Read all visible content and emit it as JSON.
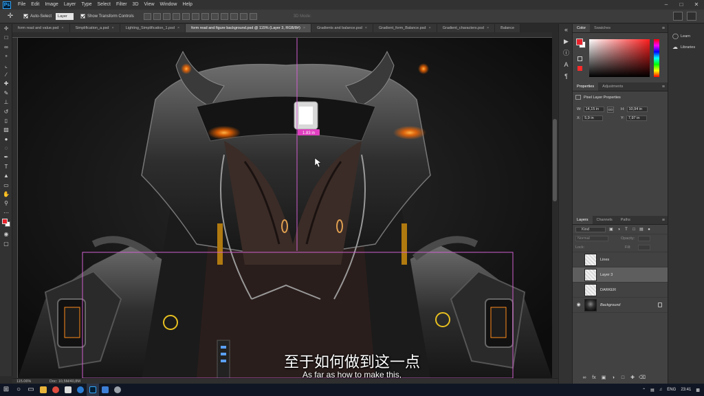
{
  "menu": [
    "File",
    "Edit",
    "Image",
    "Layer",
    "Type",
    "Select",
    "Filter",
    "3D",
    "View",
    "Window",
    "Help"
  ],
  "app_logo": "Ps",
  "options": {
    "auto_select_label": "Auto-Select",
    "auto_select_target": "Layer",
    "transform_label": "Show Transform Controls",
    "mode_3d_label": "3D Mode:"
  },
  "tabs": [
    {
      "label": "form read and value.psd",
      "active": false
    },
    {
      "label": "Simplification_a.psd",
      "active": false
    },
    {
      "label": "Lighting_Simplification_1.psd",
      "active": false
    },
    {
      "label": "form read and figure background.psd @ 115% (Layer 3, RGB/8#)",
      "active": true
    },
    {
      "label": "Gradients and balance.psd",
      "active": false
    },
    {
      "label": "Gradient_form_Balance.psd",
      "active": false
    },
    {
      "label": "Gradient_characters.psd",
      "active": false
    },
    {
      "label": "Balance",
      "active": false
    }
  ],
  "tab_close_glyph": "×",
  "canvas": {
    "measure_tooltip": "1.83 in"
  },
  "subtitles": {
    "cn": "至于如何做到这一点",
    "en": "As far as how to make this,"
  },
  "status": {
    "zoom": "115.06%",
    "doc": "Doc: 10,5M/40,8M"
  },
  "color_panel": {
    "tabs": [
      "Color",
      "Swatches"
    ],
    "fg": "#e8232c",
    "bg": "#ffffff"
  },
  "properties_panel": {
    "tabs": [
      "Properties",
      "Adjustments"
    ],
    "heading": "Pixel Layer Properties",
    "w_label": "W:",
    "w": "14,15 in",
    "go_label": "GO",
    "h_label": "H:",
    "h": "10,94 in",
    "x_label": "X:",
    "x": "5,9 in",
    "y_label": "Y:",
    "y": "7,97 in"
  },
  "layers_panel": {
    "tabs": [
      "Layers",
      "Channels",
      "Paths"
    ],
    "kind_label": "Kind",
    "blend_mode": "Normal",
    "opacity_label": "Opacity:",
    "lock_label": "Lock:",
    "fill_label": "Fill:",
    "layers": [
      {
        "name": "Lines",
        "visible": false,
        "selected": false,
        "thumb": "checker",
        "italic": false,
        "locked": false
      },
      {
        "name": "Layer 3",
        "visible": false,
        "selected": true,
        "thumb": "checker",
        "italic": false,
        "locked": false
      },
      {
        "name": "DARKER",
        "visible": false,
        "selected": false,
        "thumb": "checker",
        "italic": false,
        "locked": false
      },
      {
        "name": "Background",
        "visible": true,
        "selected": false,
        "thumb": "dark",
        "italic": true,
        "locked": true
      }
    ]
  },
  "libraries": [
    {
      "label": "Learn",
      "icon": "bulb-icon"
    },
    {
      "label": "Libraries",
      "icon": "cloud-icon"
    }
  ],
  "taskbar": {
    "language": "ENG",
    "time": "23:41"
  }
}
